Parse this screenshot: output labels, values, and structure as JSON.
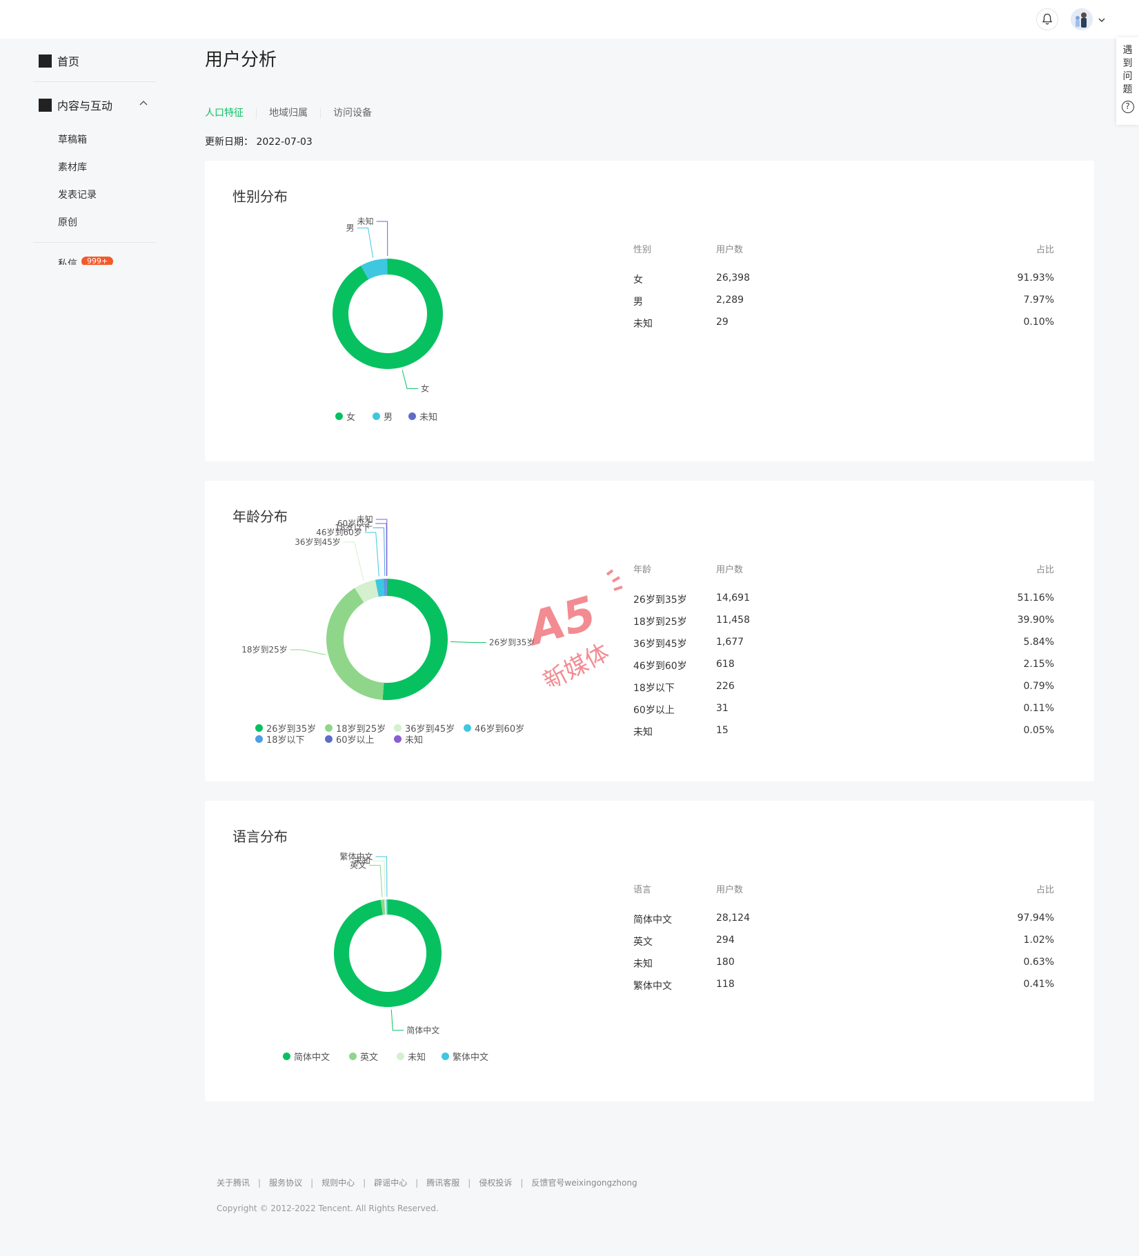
{
  "header": {
    "bell_icon": "bell-icon",
    "avatar": "avatar"
  },
  "sidebar": {
    "home": "首页",
    "content": "内容与互动",
    "sub_items": [
      "草稿箱",
      "素材库",
      "发表记录",
      "原创"
    ],
    "messages": "私信",
    "messages_badge": "999+"
  },
  "page": {
    "title": "用户分析",
    "tabs": [
      "人口特征",
      "地域归属",
      "访问设备"
    ],
    "update_label": "更新日期：",
    "update_date": "2022-07-03"
  },
  "help": {
    "chars": [
      "遇",
      "到",
      "问",
      "题"
    ],
    "icon": "?"
  },
  "colors": {
    "accent": "#07c160"
  },
  "table_headers": {
    "gender": [
      "性别",
      "用户数",
      "占比"
    ],
    "age": [
      "年龄",
      "用户数",
      "占比"
    ],
    "language": [
      "语言",
      "用户数",
      "占比"
    ]
  },
  "cards": [
    {
      "title": "性别分布",
      "rows": [
        [
          "女",
          "26,398",
          "91.93%"
        ],
        [
          "男",
          "2,289",
          "7.97%"
        ],
        [
          "未知",
          "29",
          "0.10%"
        ]
      ]
    },
    {
      "title": "年龄分布",
      "rows": [
        [
          "26岁到35岁",
          "14,691",
          "51.16%"
        ],
        [
          "18岁到25岁",
          "11,458",
          "39.90%"
        ],
        [
          "36岁到45岁",
          "1,677",
          "5.84%"
        ],
        [
          "46岁到60岁",
          "618",
          "2.15%"
        ],
        [
          "18岁以下",
          "226",
          "0.79%"
        ],
        [
          "60岁以上",
          "31",
          "0.11%"
        ],
        [
          "未知",
          "15",
          "0.05%"
        ]
      ]
    },
    {
      "title": "语言分布",
      "rows": [
        [
          "简体中文",
          "28,124",
          "97.94%"
        ],
        [
          "英文",
          "294",
          "1.02%"
        ],
        [
          "未知",
          "180",
          "0.63%"
        ],
        [
          "繁体中文",
          "118",
          "0.41%"
        ]
      ]
    }
  ],
  "chart_data": [
    {
      "type": "pie",
      "categories": [
        "女",
        "男",
        "未知"
      ],
      "values": [
        26398,
        2289,
        29
      ],
      "colors": [
        "#07c160",
        "#3ec7e0",
        "#5b6cc9"
      ]
    },
    {
      "type": "pie",
      "categories": [
        "26岁到35岁",
        "18岁到25岁",
        "36岁到45岁",
        "46岁到60岁",
        "18岁以下",
        "60岁以上",
        "未知"
      ],
      "values": [
        14691,
        11458,
        1677,
        618,
        226,
        31,
        15
      ],
      "colors": [
        "#07c160",
        "#8fd68a",
        "#d4f0cf",
        "#3ec7e0",
        "#4c9ee8",
        "#5b6cc9",
        "#8a5cd6"
      ]
    },
    {
      "type": "pie",
      "categories": [
        "简体中文",
        "英文",
        "未知",
        "繁体中文"
      ],
      "values": [
        28124,
        294,
        180,
        118
      ],
      "colors": [
        "#07c160",
        "#8fd68a",
        "#d4f0cf",
        "#3ec7e0"
      ]
    }
  ],
  "footer": {
    "links": [
      "关于腾讯",
      "服务协议",
      "规则中心",
      "辟谣中心",
      "腾讯客服",
      "侵权投诉",
      "反馈官号weixingongzhong"
    ],
    "copyright": "Copyright © 2012-2022 Tencent. All Rights Reserved."
  },
  "watermark": {
    "line1": "A5",
    "line2": "新媒体"
  }
}
